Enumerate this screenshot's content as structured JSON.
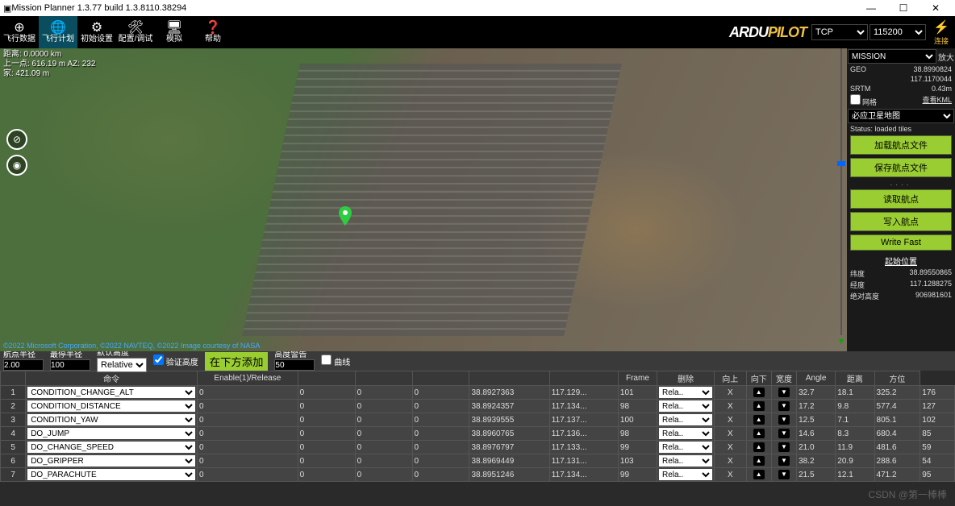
{
  "window": {
    "title": "Mission Planner 1.3.77 build 1.3.8110.38294",
    "min": "—",
    "max": "☐",
    "close": "✕"
  },
  "toolbar": {
    "items": [
      {
        "icon": "⊕",
        "label": "飞行数据"
      },
      {
        "icon": "🌐",
        "label": "飞行计划"
      },
      {
        "icon": "⚙",
        "label": "初始设置"
      },
      {
        "icon": "🛠",
        "label": "配置/调试"
      },
      {
        "icon": "🖥",
        "label": "模拟"
      },
      {
        "icon": "❓",
        "label": "帮助"
      }
    ],
    "logo_a": "ARDU",
    "logo_p": "PILOT"
  },
  "conn": {
    "proto": "TCP",
    "baud": "115200",
    "link": "连接"
  },
  "map": {
    "line1": "距离: 0.0000 km",
    "line2": "上一点: 616.19 m AZ: 232",
    "line3": "家: 421.09 m",
    "copyright": "©2022 Microsoft Corporation, ©2022 NAVTEQ, ©2022 Image courtesy of NASA",
    "compass": [
      "⊘",
      "◉"
    ]
  },
  "rside": {
    "mission": "MISSION",
    "zoom": "放大",
    "geo": "GEO",
    "lat": "38.8990824",
    "lon": "117.1170044",
    "srtm": "SRTM",
    "alt": "0.43m",
    "grid_chk": "网格",
    "kml": "查看KML",
    "maptype": "必应卫星地图",
    "status": "Status: loaded tiles",
    "btn_load": "加载航点文件",
    "btn_save": "保存航点文件",
    "dots": "....",
    "btn_read": "读取航点",
    "btn_write": "写入航点",
    "btn_fast": "Write Fast",
    "home_title": "起始位置",
    "home_lat_l": "纬度",
    "home_lat_v": "38.89550865",
    "home_lon_l": "经度",
    "home_lon_v": "117.1288275",
    "home_alt_l": "绝对高度",
    "home_alt_v": "906981601"
  },
  "mid": {
    "wp_r_l": "航点半径",
    "wp_r_v": "2.00",
    "lt_r_l": "最停半径",
    "lt_r_v": "100",
    "alt_l": "默认高度",
    "alt_sel": "Relative",
    "verify": "验证高度",
    "add": "在下方添加",
    "warn_l": "高度警告",
    "warn_v": "50",
    "spline": "曲线"
  },
  "cols": [
    "",
    "命令",
    "Enable(1)/Release",
    "",
    "",
    "",
    "",
    "",
    "Frame",
    "删除",
    "向上",
    "向下",
    "宽度",
    "Angle",
    "距离",
    "方位"
  ],
  "rows": [
    {
      "n": "1",
      "cmd": "CONDITION_CHANGE_ALT",
      "c1": "0",
      "c2": "0",
      "c3": "0",
      "c4": "0",
      "lat": "38.8927363",
      "lon": "117.129...",
      "alt": "101",
      "frame": "Rela..",
      "del": "X",
      "grad": "32.7",
      "ang": "18.1",
      "dist": "325.2",
      "az": "176"
    },
    {
      "n": "2",
      "cmd": "CONDITION_DISTANCE",
      "c1": "0",
      "c2": "0",
      "c3": "0",
      "c4": "0",
      "lat": "38.8924357",
      "lon": "117.134...",
      "alt": "98",
      "frame": "Rela..",
      "del": "X",
      "grad": "17.2",
      "ang": "9.8",
      "dist": "577.4",
      "az": "127"
    },
    {
      "n": "3",
      "cmd": "CONDITION_YAW",
      "c1": "0",
      "c2": "0",
      "c3": "0",
      "c4": "0",
      "lat": "38.8939555",
      "lon": "117.137...",
      "alt": "100",
      "frame": "Rela..",
      "del": "X",
      "grad": "12.5",
      "ang": "7.1",
      "dist": "805.1",
      "az": "102"
    },
    {
      "n": "4",
      "cmd": "DO_JUMP",
      "c1": "0",
      "c2": "0",
      "c3": "0",
      "c4": "0",
      "lat": "38.8960765",
      "lon": "117.136...",
      "alt": "98",
      "frame": "Rela..",
      "del": "X",
      "grad": "14.6",
      "ang": "8.3",
      "dist": "680.4",
      "az": "85"
    },
    {
      "n": "5",
      "cmd": "DO_CHANGE_SPEED",
      "c1": "0",
      "c2": "0",
      "c3": "0",
      "c4": "0",
      "lat": "38.8976797",
      "lon": "117.133...",
      "alt": "99",
      "frame": "Rela..",
      "del": "X",
      "grad": "21.0",
      "ang": "11.9",
      "dist": "481.6",
      "az": "59"
    },
    {
      "n": "6",
      "cmd": "DO_GRIPPER",
      "c1": "0",
      "c2": "0",
      "c3": "0",
      "c4": "0",
      "lat": "38.8969449",
      "lon": "117.131...",
      "alt": "103",
      "frame": "Rela..",
      "del": "X",
      "grad": "38.2",
      "ang": "20.9",
      "dist": "288.6",
      "az": "54"
    },
    {
      "n": "7",
      "cmd": "DO_PARACHUTE",
      "c1": "0",
      "c2": "0",
      "c3": "0",
      "c4": "0",
      "lat": "38.8951246",
      "lon": "117.134...",
      "alt": "99",
      "frame": "Rela..",
      "del": "X",
      "grad": "21.5",
      "ang": "12.1",
      "dist": "471.2",
      "az": "95"
    }
  ],
  "watermark": "CSDN @第一棒棒"
}
